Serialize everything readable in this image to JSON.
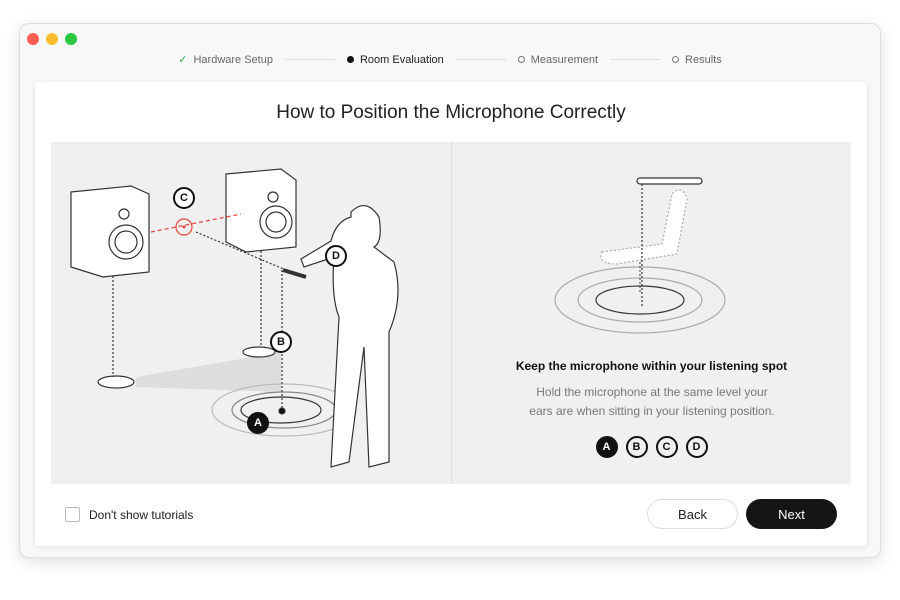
{
  "window": {
    "controls": [
      {
        "name": "close",
        "color": "#ff5f57"
      },
      {
        "name": "minimize",
        "color": "#febc2e"
      },
      {
        "name": "maximize",
        "color": "#28c840"
      }
    ]
  },
  "steps": [
    {
      "label": "Hardware Setup",
      "state": "done"
    },
    {
      "label": "Room Evaluation",
      "state": "active"
    },
    {
      "label": "Measurement",
      "state": "pending"
    },
    {
      "label": "Results",
      "state": "pending"
    }
  ],
  "title": "How to Position the Microphone Correctly",
  "illustration": {
    "labels": [
      "A",
      "B",
      "C",
      "D"
    ]
  },
  "tip": {
    "heading": "Keep the microphone within your listening spot",
    "line1": "Hold the microphone at the same level your",
    "line2": "ears are when sitting in your listening position.",
    "badges": [
      "A",
      "B",
      "C",
      "D"
    ],
    "active_badge": "A"
  },
  "footer": {
    "checkbox_label": "Don't show tutorials",
    "checked": false,
    "back": "Back",
    "next": "Next"
  },
  "colors": {
    "accent": "#111111",
    "target": "#e8453c",
    "check": "#2db34a"
  }
}
